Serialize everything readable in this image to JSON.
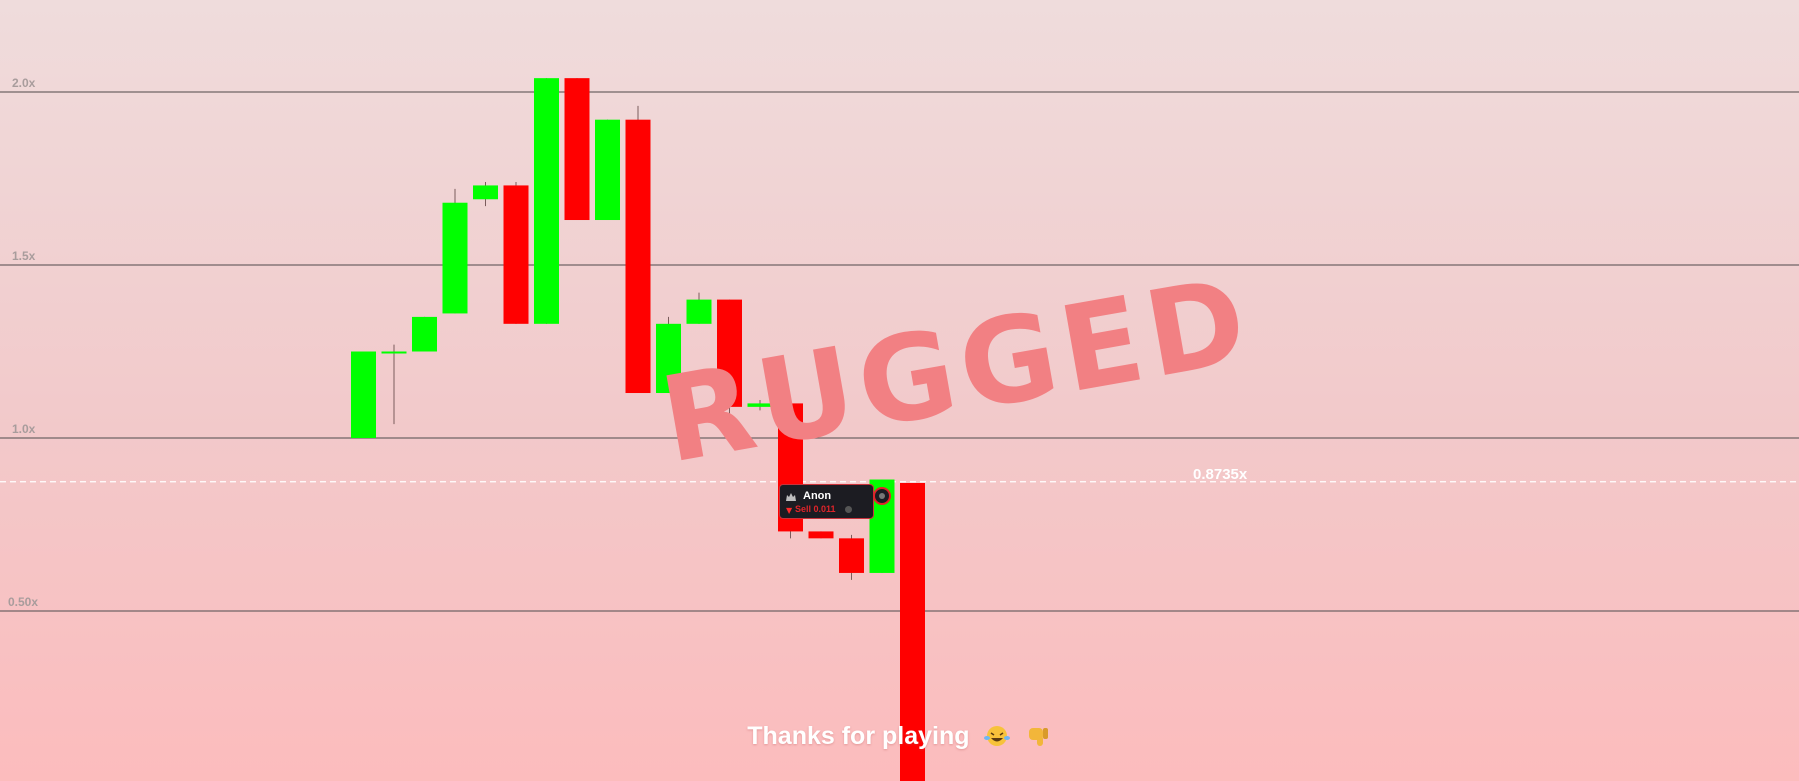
{
  "game": {
    "status_stamp": "RUGGED",
    "current_multiplier": "0.8735x",
    "footer_message": "Thanks for playing",
    "footer_emojis": [
      "laughing-crying-emoji-icon",
      "thumbs-down-emoji-icon"
    ],
    "trade_popup": {
      "player_name": "Anon",
      "action": "Sell 0.011",
      "action_icon": "down-arrow-icon",
      "avatar_icon": "anon-avatar-icon",
      "coin_icon": "coin-icon"
    },
    "colors": {
      "up": "#00ff00",
      "down": "#ff0000",
      "stamp": "#f28083",
      "popup_bg": "#1c1c22",
      "popup_border": "#c8333b"
    }
  },
  "chart_data": {
    "type": "candlestick",
    "ylim": [
      0.0,
      2.05
    ],
    "y_tick_labels": [
      "2.0x",
      "1.5x",
      "1.0x",
      "0.50x"
    ],
    "y_ticks": [
      2.0,
      1.5,
      1.0,
      0.5
    ],
    "reference_line": {
      "label": "0.8735x",
      "value": 0.8735,
      "style": "dashed"
    },
    "candles": [
      {
        "open": 1.0,
        "close": 1.25,
        "high": 1.25,
        "low": 1.0
      },
      {
        "open": 1.25,
        "close": 1.25,
        "high": 1.27,
        "low": 1.04
      },
      {
        "open": 1.25,
        "close": 1.35,
        "high": 1.35,
        "low": 1.25
      },
      {
        "open": 1.36,
        "close": 1.68,
        "high": 1.72,
        "low": 1.36
      },
      {
        "open": 1.69,
        "close": 1.73,
        "high": 1.74,
        "low": 1.67
      },
      {
        "open": 1.73,
        "close": 1.33,
        "high": 1.74,
        "low": 1.33
      },
      {
        "open": 1.33,
        "close": 2.04,
        "high": 2.04,
        "low": 1.33
      },
      {
        "open": 2.04,
        "close": 1.63,
        "high": 2.04,
        "low": 1.63
      },
      {
        "open": 1.63,
        "close": 1.92,
        "high": 1.92,
        "low": 1.63
      },
      {
        "open": 1.92,
        "close": 1.13,
        "high": 1.96,
        "low": 1.13
      },
      {
        "open": 1.13,
        "close": 1.33,
        "high": 1.35,
        "low": 1.13
      },
      {
        "open": 1.33,
        "close": 1.4,
        "high": 1.42,
        "low": 1.33
      },
      {
        "open": 1.4,
        "close": 1.09,
        "high": 1.4,
        "low": 1.06
      },
      {
        "open": 1.09,
        "close": 1.1,
        "high": 1.11,
        "low": 1.08
      },
      {
        "open": 1.1,
        "close": 0.73,
        "high": 1.1,
        "low": 0.71
      },
      {
        "open": 0.73,
        "close": 0.71,
        "high": 0.73,
        "low": 0.71
      },
      {
        "open": 0.71,
        "close": 0.61,
        "high": 0.72,
        "low": 0.59
      },
      {
        "open": 0.61,
        "close": 0.88,
        "high": 0.88,
        "low": 0.61
      },
      {
        "open": 0.87,
        "close": 0.0,
        "high": 0.87,
        "low": 0.0
      }
    ]
  }
}
